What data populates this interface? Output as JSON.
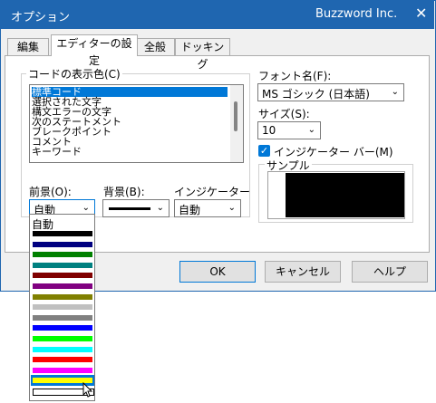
{
  "window": {
    "title": "オプション",
    "brand": "Buzzword Inc.",
    "close_glyph": "✕",
    "accent": "#1f66b0"
  },
  "tabs": [
    {
      "label": "編集"
    },
    {
      "label": "エディターの設定",
      "active": true
    },
    {
      "label": "全般"
    },
    {
      "label": "ドッキング"
    }
  ],
  "code_colors": {
    "label": "コードの表示色(C)",
    "items": [
      "標準コード",
      "選択された文字",
      "構文エラーの文字",
      "次のステートメント",
      "ブレークポイント",
      "コメント",
      "キーワード"
    ],
    "selected_index": 0
  },
  "foreground": {
    "label": "前景(O):",
    "value": "自動"
  },
  "background": {
    "label": "背景(B):",
    "value": "black-line"
  },
  "indicator": {
    "label": "インジケーター",
    "value": "自動"
  },
  "font": {
    "label": "フォント名(F):",
    "value": "MS ゴシック (日本語)"
  },
  "size": {
    "label": "サイズ(S):",
    "value": "10"
  },
  "indicator_bar": {
    "label": "インジケーター バー(M)",
    "checked": true
  },
  "sample": {
    "label": "サンプル"
  },
  "buttons": {
    "ok": "OK",
    "cancel": "キャンセル",
    "help": "ヘルプ"
  },
  "dropdown": {
    "first": "自動",
    "colors": [
      "#000000",
      "#000080",
      "#008000",
      "#008080",
      "#800000",
      "#800080",
      "#808000",
      "#c0c0c0",
      "#808080",
      "#0000ff",
      "#00ff00",
      "#00ffff",
      "#ff0000",
      "#ff00ff",
      "#ffff00",
      "#ffffff"
    ],
    "highlighted_index": 14
  },
  "icons": {
    "chevron": "chevron-down-icon",
    "check": "check-icon",
    "close": "close-icon",
    "cursor": "mouse-cursor-icon"
  }
}
